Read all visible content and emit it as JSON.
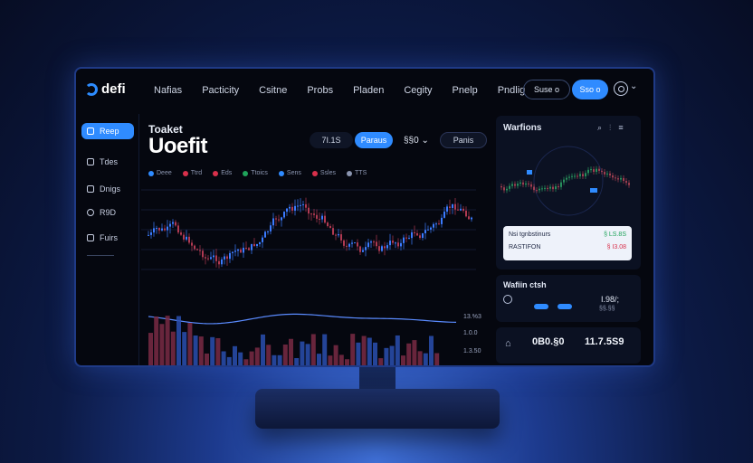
{
  "app": {
    "logo_text": "defi"
  },
  "nav": [
    "Nafias",
    "Pacticity",
    "Csitne",
    "Probs",
    "Pladen",
    "Cegity",
    "Pnelp",
    "Pndlig"
  ],
  "header_buttons": {
    "outline": "Suse o",
    "primary": "Sso o"
  },
  "sidebar": {
    "items": [
      {
        "label": "Reep",
        "active": true
      },
      {
        "label": "Tdes",
        "active": false
      },
      {
        "label": "Dnigs",
        "active": false
      },
      {
        "label": "R9D",
        "active": false
      },
      {
        "label": "Fuirs",
        "active": false
      }
    ]
  },
  "main": {
    "subtitle": "Toaket",
    "title": "Uoefit",
    "pill_value": "7I.1S",
    "pill_blue": "Paraus",
    "dropdown": "§§0",
    "pill_dark": "Panis",
    "legend": [
      {
        "label": "Deee",
        "color": "#2f8bff"
      },
      {
        "label": "Ttrd",
        "color": "#d9304b"
      },
      {
        "label": "Eds",
        "color": "#d9304b"
      },
      {
        "label": "Ttoics",
        "color": "#1fa35a"
      },
      {
        "label": "Sens",
        "color": "#2f8bff"
      },
      {
        "label": "Ssles",
        "color": "#d9304b"
      },
      {
        "label": "TTS",
        "color": "#8b95b0"
      }
    ],
    "y_labels": [
      "13.%3",
      "1.0.0",
      "1.3.50"
    ]
  },
  "right_panel": {
    "title": "Warfions",
    "card": {
      "row1_left": "Nsi tgnbstinurs",
      "row1_right": "§ LS.8S",
      "row2_left": "RASTIFON",
      "row2_right": "§ I3.08"
    }
  },
  "wallet": {
    "title": "Wafiin ctsh",
    "value": "I.98/;",
    "sub": "§§.§§"
  },
  "bottom": {
    "value1": "0B0.§0",
    "value2": "11.7.5S9"
  },
  "colors": {
    "accent": "#2f8bff",
    "up": "#1fa35a",
    "down": "#d9304b"
  }
}
